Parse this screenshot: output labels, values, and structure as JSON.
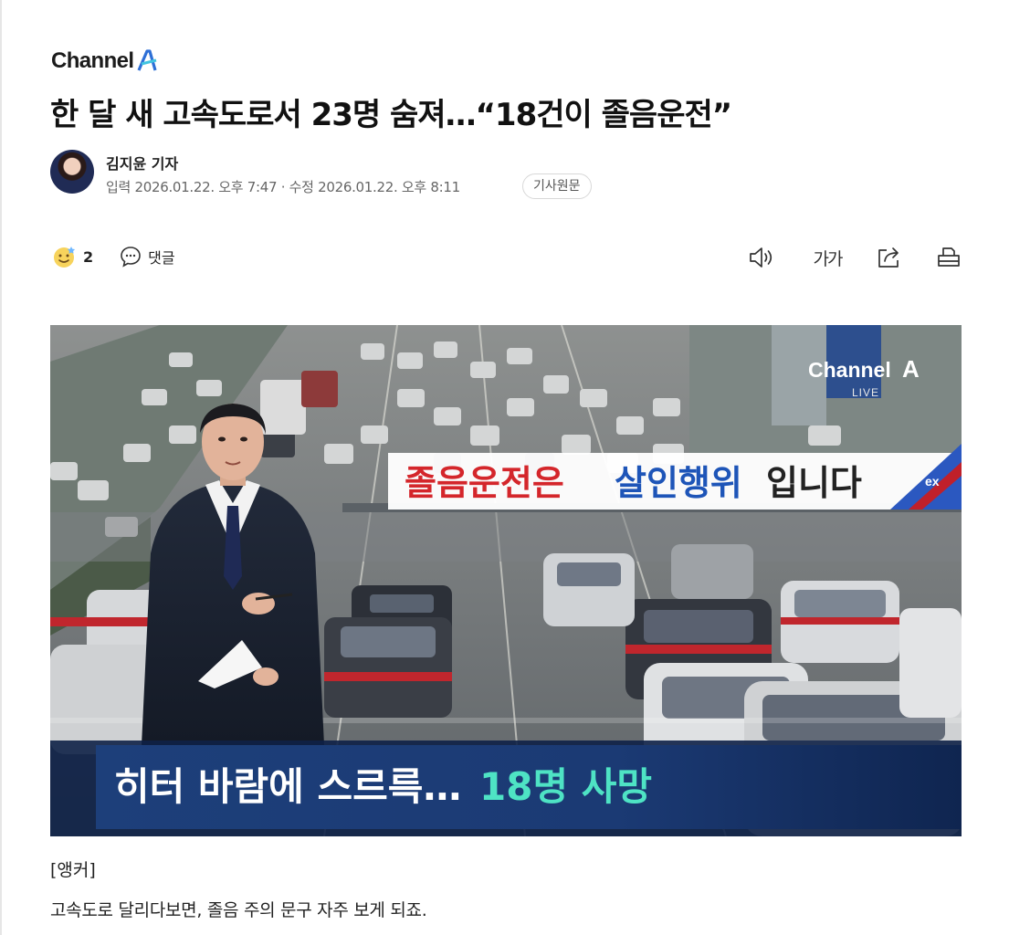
{
  "brand": {
    "name": "Channel",
    "mark": "A",
    "accent": "#2e6fd6",
    "accent2": "#41c4e0"
  },
  "article": {
    "headline": "한 달 새 고속도로서 23명 숨져…“18건이 졸음운전”",
    "reporter": "김지윤 기자",
    "dates": "입력 2026.01.22. 오후 7:47 · 수정 2026.01.22. 오후 8:11",
    "original_button": "기사원문"
  },
  "toolbar": {
    "reaction_icon": "smiley-icon",
    "reaction_count": "2",
    "comment_icon": "speech-bubble-icon",
    "comment_label": "댓글",
    "font_size_label": "가가",
    "icons": [
      "speaker-icon",
      "font-size-icon",
      "share-icon",
      "print-icon"
    ]
  },
  "video": {
    "banner_red": "졸음운전은",
    "banner_blue": "살인행위",
    "banner_tail": "입니다",
    "ex_badge": "ex",
    "channel_name": "Channel",
    "channel_mark": "A",
    "live_label": "LIVE",
    "caption_white": "히터 바람에 스르륵…",
    "caption_green": "18명 사망"
  },
  "body": {
    "anchor_tag": "[앵커]",
    "first_line": "고속도로 달리다보면, 졸음 주의 문구 자주 보게 되죠."
  }
}
